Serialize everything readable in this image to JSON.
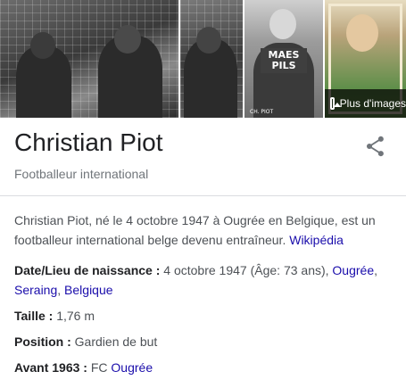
{
  "gallery": {
    "photo3_caption": "MAES PILS",
    "photo3_credit": "CH. PIOT",
    "more_images_label": "Plus d'images"
  },
  "header": {
    "title": "Christian Piot",
    "subtitle": "Footballeur international"
  },
  "description": {
    "text": "Christian Piot, né le 4 octobre 1947 à Ougrée en Belgique, est un footballeur international belge devenu entraîneur. ",
    "source_link": "Wikipédia"
  },
  "facts": {
    "birth": {
      "label": "Date/Lieu de naissance :",
      "value": " 4 octobre 1947 (Âge: 73 ans), ",
      "link_ougree": "Ougrée",
      "sep": ",",
      "link_seraing": "Seraing",
      "sep2": ", ",
      "link_belgique": "Belgique"
    },
    "height": {
      "label": "Taille :",
      "value": " 1,76 m"
    },
    "position": {
      "label": "Position :",
      "value": " Gardien de but"
    },
    "before1963": {
      "label": "Avant 1963 :",
      "value": " FC ",
      "link": "Ougrée"
    }
  },
  "icons": {
    "share": "share-icon",
    "images": "image-icon"
  }
}
